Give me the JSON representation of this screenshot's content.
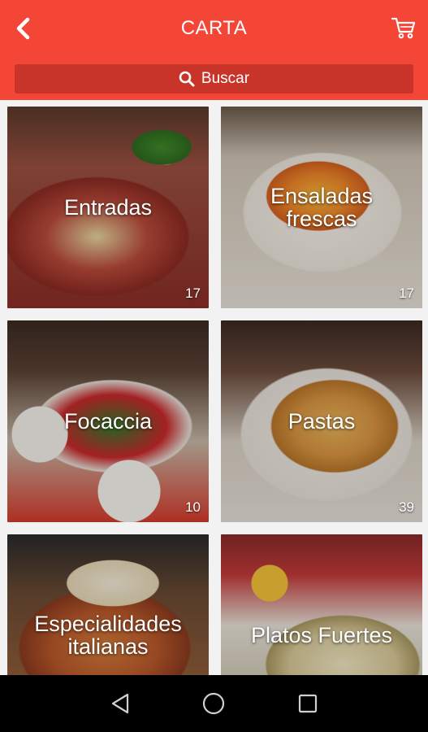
{
  "header": {
    "title": "CARTA",
    "back_icon": "chevron-left-icon",
    "cart_icon": "shopping-cart-icon",
    "color": "#f44636"
  },
  "search": {
    "label": "Buscar",
    "icon": "search-icon",
    "color": "#c9342a"
  },
  "categories": [
    {
      "name": "Entradas",
      "count": "17"
    },
    {
      "name": "Ensaladas frescas",
      "count": "17"
    },
    {
      "name": "Focaccia",
      "count": "10"
    },
    {
      "name": "Pastas",
      "count": "39"
    },
    {
      "name": "Especialidades italianas",
      "count": ""
    },
    {
      "name": "Platos Fuertes",
      "count": ""
    }
  ],
  "system_nav": {
    "back_icon": "triangle-back-icon",
    "home_icon": "circle-home-icon",
    "recents_icon": "square-recents-icon"
  }
}
